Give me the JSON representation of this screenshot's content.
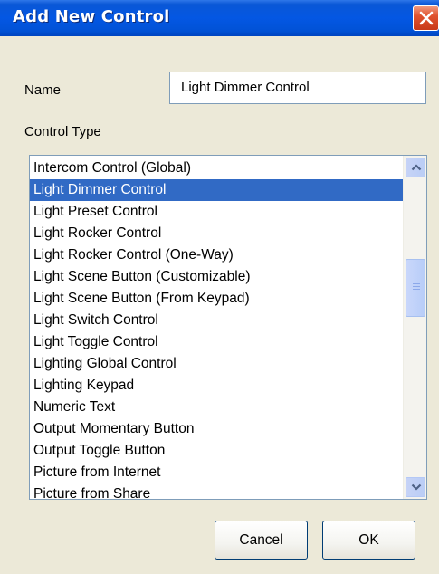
{
  "dialog": {
    "title": "Add New Control",
    "name_label": "Name",
    "name_value": "Light Dimmer Control",
    "control_type_label": "Control Type",
    "cancel_label": "Cancel",
    "ok_label": "OK"
  },
  "control_types": [
    "Intercom Control (Global)",
    "Light Dimmer Control",
    "Light Preset Control",
    "Light Rocker Control",
    "Light Rocker Control (One-Way)",
    "Light Scene Button (Customizable)",
    "Light Scene Button (From Keypad)",
    "Light Switch Control",
    "Light Toggle Control",
    "Lighting Global Control",
    "Lighting Keypad",
    "Numeric Text",
    "Output Momentary Button",
    "Output Toggle Button",
    "Picture from Internet",
    "Picture from Share"
  ],
  "selected_control_type": "Light Dimmer Control",
  "icons": {
    "close": "close-icon",
    "scroll_up": "chevron-up-icon",
    "scroll_down": "chevron-down-icon"
  },
  "colors": {
    "titlebar": "#0457e3",
    "selection": "#316ac5",
    "close_button": "#e0532f"
  }
}
